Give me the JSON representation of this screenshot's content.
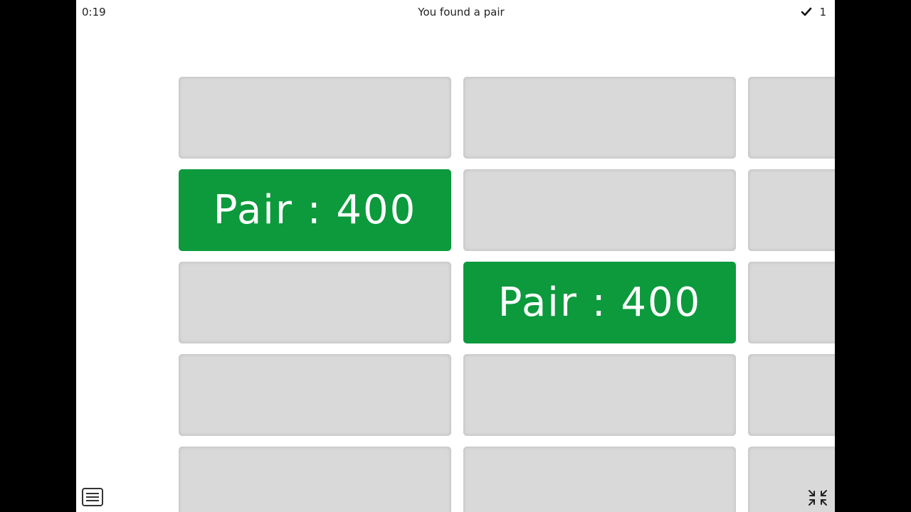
{
  "header": {
    "timer": "0:19",
    "status": "You found a pair",
    "score": "1",
    "score_icon": "checkmark-icon"
  },
  "cards": [
    {
      "row": 0,
      "col": 0,
      "revealed": false,
      "label": ""
    },
    {
      "row": 0,
      "col": 1,
      "revealed": false,
      "label": ""
    },
    {
      "row": 0,
      "col": 2,
      "revealed": false,
      "label": ""
    },
    {
      "row": 1,
      "col": 0,
      "revealed": true,
      "label": "Pair : 400"
    },
    {
      "row": 1,
      "col": 1,
      "revealed": false,
      "label": ""
    },
    {
      "row": 1,
      "col": 2,
      "revealed": false,
      "label": ""
    },
    {
      "row": 2,
      "col": 0,
      "revealed": false,
      "label": ""
    },
    {
      "row": 2,
      "col": 1,
      "revealed": true,
      "label": "Pair : 400"
    },
    {
      "row": 2,
      "col": 2,
      "revealed": false,
      "label": ""
    },
    {
      "row": 3,
      "col": 0,
      "revealed": false,
      "label": ""
    },
    {
      "row": 3,
      "col": 1,
      "revealed": false,
      "label": ""
    },
    {
      "row": 3,
      "col": 2,
      "revealed": false,
      "label": ""
    },
    {
      "row": 4,
      "col": 0,
      "revealed": false,
      "label": ""
    },
    {
      "row": 4,
      "col": 1,
      "revealed": false,
      "label": ""
    },
    {
      "row": 4,
      "col": 2,
      "revealed": false,
      "label": ""
    }
  ],
  "colors": {
    "revealed": "#0c9a3c",
    "hidden": "#d9d9d9"
  },
  "controls": {
    "menu_icon": "hamburger-menu-icon",
    "shrink_icon": "exit-fullscreen-icon"
  }
}
